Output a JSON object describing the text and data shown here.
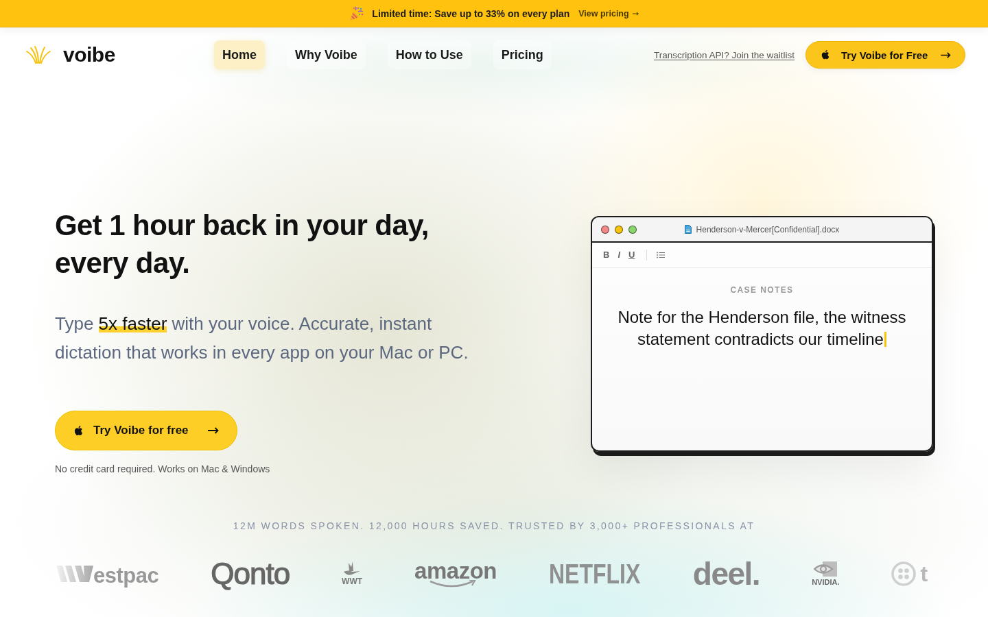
{
  "banner": {
    "text": "Limited time: Save up to 33% on every plan",
    "link": "View pricing"
  },
  "nav": {
    "brand": "voibe",
    "tabs": [
      {
        "label": "Home",
        "selected": true
      },
      {
        "label": "Why Voibe",
        "selected": false
      },
      {
        "label": "How to Use",
        "selected": false
      },
      {
        "label": "Pricing",
        "selected": false
      }
    ],
    "api_link": "Transcription API? Join the waitlist",
    "cta": "Try Voibe for Free"
  },
  "hero": {
    "title": "Get 1 hour back in your day, every day.",
    "subtitle": "Type **5x faster** with your voice. Accurate, instant dictation that works in every app on your Mac or PC.",
    "cta": "Try Voibe for free",
    "note": "No credit card required. Works on Mac & Windows"
  },
  "editor": {
    "filename": "Henderson-v-Mercer[Confidential].docx",
    "toolbar": [
      {
        "label": "B",
        "kind": "bold"
      },
      {
        "label": "I",
        "kind": "italic"
      },
      {
        "label": "U",
        "kind": "underline"
      }
    ],
    "heading": "CASE NOTES",
    "text": "Note for the Henderson file, the witness statement contradicts our timeline"
  },
  "social_proof": {
    "headline": "12M WORDS SPOKEN. 12,000 HOURS SAVED. TRUSTED BY 3,000+ PROFESSIONALS AT",
    "logos": [
      {
        "wordmark": "estpac",
        "kind": "stripes"
      },
      {
        "wordmark": "Qonto",
        "kind": "round"
      },
      {
        "wordmark": "WWT",
        "kind": "bird"
      },
      {
        "wordmark": "amazon",
        "kind": "smile"
      },
      {
        "wordmark": "NETFLIX",
        "kind": "condensed"
      },
      {
        "wordmark": "deel.",
        "kind": "heavy"
      },
      {
        "wordmark": "NVIDIA.",
        "kind": "eye"
      },
      {
        "wordmark": "t",
        "kind": "ring"
      }
    ]
  }
}
